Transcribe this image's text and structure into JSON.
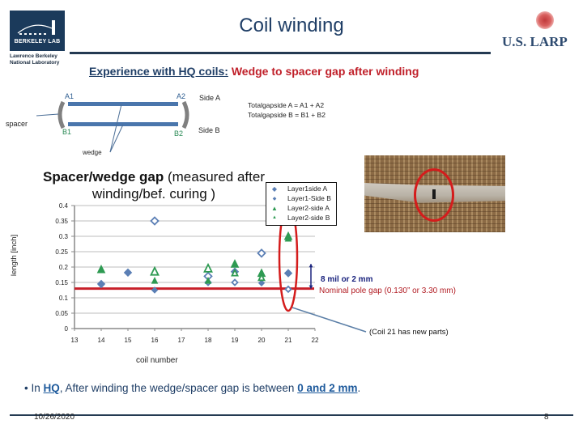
{
  "header": {
    "title": "Coil winding",
    "left_logo": {
      "name": "BERKELEY LAB",
      "subtitle_lines": [
        "Lawrence Berkeley",
        "National Laboratory"
      ]
    },
    "right_logo": {
      "name": "U.S. LARP"
    }
  },
  "subtitle": {
    "underlined": "Experience with HQ coils:",
    "red": " Wedge to spacer gap after winding"
  },
  "schematic": {
    "labels": {
      "a1": "A1",
      "a2": "A2",
      "b1": "B1",
      "b2": "B2",
      "side_a": "Side A",
      "side_b": "Side  B",
      "spacer": "spacer",
      "wedge": "wedge"
    },
    "formulas": [
      "Totalgapside A = A1 + A2",
      "Totalgapside B = B1 + B2"
    ]
  },
  "chart_data": {
    "type": "scatter",
    "title_bold": "Spacer/wedge gap",
    "title_rest": " (measured after winding/bef. curing )",
    "xlabel": "coil number",
    "ylabel": "length [inch]",
    "xlim": [
      13,
      22
    ],
    "ylim": [
      0,
      0.4
    ],
    "xticks": [
      "13",
      "14",
      "15",
      "16",
      "17",
      "18",
      "19",
      "20",
      "21",
      "22"
    ],
    "yticks": [
      "0",
      "0.05",
      "0.1",
      "0.15",
      "0.2",
      "0.25",
      "0.3",
      "0.35",
      "0.4"
    ],
    "grid": true,
    "legend_position": "top-right",
    "series": [
      {
        "name": "Layer1side A",
        "marker": "diamond",
        "color": "#5b7fb5",
        "points": [
          [
            14,
            0.145
          ],
          [
            15,
            0.182
          ],
          [
            16,
            0.35
          ],
          [
            18,
            0.17
          ],
          [
            19,
            0.185
          ],
          [
            20,
            0.245
          ],
          [
            21,
            0.18
          ]
        ],
        "hollow": [
          false,
          false,
          true,
          true,
          false,
          true,
          false
        ]
      },
      {
        "name": "Layer1-Side B",
        "marker": "diamond-small",
        "color": "#5b7fb5",
        "points": [
          [
            14,
            0.142
          ],
          [
            15,
            0.184
          ],
          [
            16,
            0.125
          ],
          [
            18,
            0.15
          ],
          [
            19,
            0.15
          ],
          [
            20,
            0.148
          ],
          [
            21,
            0.128
          ]
        ],
        "hollow": [
          false,
          false,
          false,
          true,
          true,
          false,
          true
        ]
      },
      {
        "name": "Layer2-side A",
        "marker": "triangle",
        "color": "#2e9a52",
        "points": [
          [
            14,
            0.192
          ],
          [
            16,
            0.185
          ],
          [
            18,
            0.195
          ],
          [
            19,
            0.21
          ],
          [
            20,
            0.18
          ],
          [
            21,
            0.3
          ]
        ],
        "hollow": [
          false,
          true,
          true,
          false,
          false,
          false
        ]
      },
      {
        "name": "Layer2-side B",
        "marker": "triangle-small",
        "color": "#2e9a52",
        "points": [
          [
            14,
            0.19
          ],
          [
            16,
            0.155
          ],
          [
            18,
            0.155
          ],
          [
            19,
            0.18
          ],
          [
            20,
            0.165
          ],
          [
            21,
            0.292
          ]
        ],
        "hollow": [
          false,
          false,
          false,
          true,
          true,
          false
        ]
      }
    ],
    "reference_line": {
      "value": 0.13,
      "color": "#c8202a",
      "label": "Nominal pole gap (0.130”  or 3.30 mm)"
    },
    "range_arrow": {
      "from": 0.13,
      "to": 0.21,
      "color": "#1a237e",
      "label": "8 mil or 2 mm"
    },
    "highlight": {
      "coil": 21,
      "note": "(Coil 21 has new parts)",
      "color": "#d41c1c"
    }
  },
  "bullet": {
    "prefix": "• In ",
    "hq": "HQ",
    "middle": ", After winding the wedge/spacer gap is between ",
    "range": "0 and 2 mm",
    "suffix": "."
  },
  "footer": {
    "date": "10/26/2020",
    "page": "8"
  }
}
